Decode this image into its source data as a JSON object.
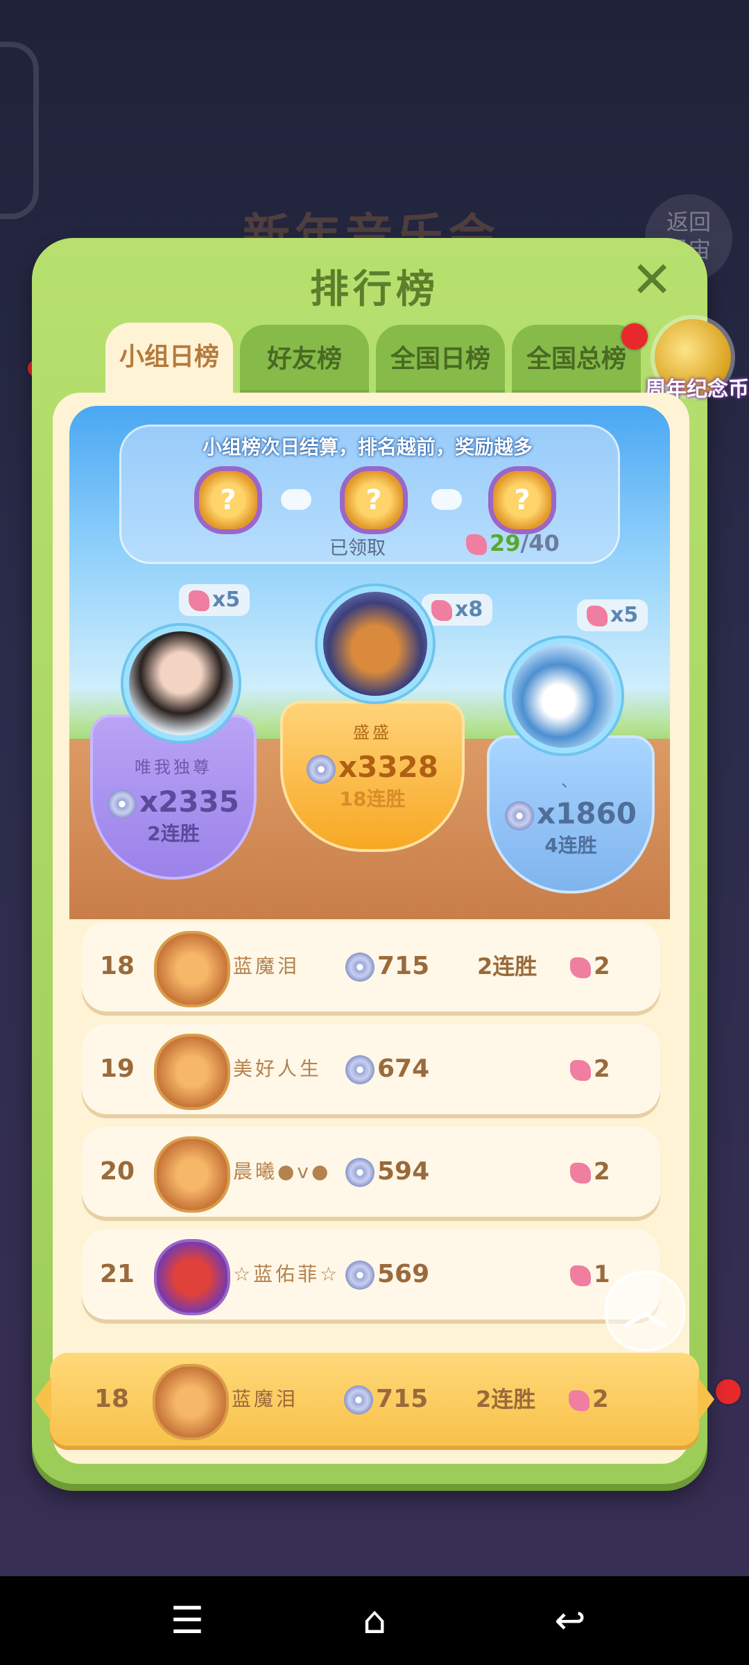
{
  "background": {
    "event_title": "新年音乐会",
    "back_label": "返回\n星宙"
  },
  "modal": {
    "title": "排行榜"
  },
  "tabs": [
    "小组日榜",
    "好友榜",
    "全国日榜",
    "全国总榜"
  ],
  "anniversary_coin_label": "周年纪念币",
  "reward_track": {
    "title": "小组榜次日结算，排名越前，奖励越多",
    "claimed_label": "已领取",
    "progress_current": "29",
    "progress_total": "/40",
    "chest_mark": "?"
  },
  "podium": {
    "first": {
      "petals": "x8",
      "name": "盛盛",
      "score": "x3328",
      "streak": "18连胜"
    },
    "second": {
      "petals": "x5",
      "name": "唯我独尊",
      "score": "x2335",
      "streak": "2连胜"
    },
    "third": {
      "petals": "x5",
      "name": "、",
      "score": "x1860",
      "streak": "4连胜"
    }
  },
  "rows": [
    {
      "rank": "18",
      "name": "蓝魔泪",
      "score": "715",
      "streak": "2连胜",
      "petals": "2"
    },
    {
      "rank": "19",
      "name": "美好人生",
      "score": "674",
      "streak": "",
      "petals": "2"
    },
    {
      "rank": "20",
      "name": "晨曦●v●",
      "score": "594",
      "streak": "",
      "petals": "2"
    },
    {
      "rank": "21",
      "name": "☆蓝佑菲☆",
      "score": "569",
      "streak": "",
      "petals": "1"
    }
  ],
  "my_row": {
    "rank": "18",
    "name": "蓝魔泪",
    "score": "715",
    "streak": "2连胜",
    "petals": "2"
  },
  "icons": {
    "close": "close-icon",
    "scroll_top": "chevron-up-icon",
    "nav_menu": "menu-icon",
    "nav_home": "home-icon",
    "nav_back": "back-icon"
  },
  "colors": {
    "panel_green": "#9ccd58",
    "highlight_yellow": "#f8c14a",
    "text_brown": "#9a6a3b"
  }
}
